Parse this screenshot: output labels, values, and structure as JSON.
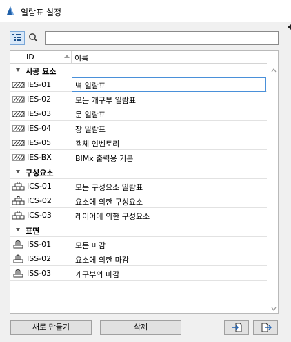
{
  "window": {
    "title": "일람표 설정"
  },
  "search": {
    "placeholder": "",
    "value": ""
  },
  "columns": {
    "id": "ID",
    "name": "이름"
  },
  "groups": [
    {
      "label": "시공 요소",
      "icon": "hatch-icon",
      "rows": [
        {
          "id": "IES-01",
          "name": "벽 일람표",
          "selected": true
        },
        {
          "id": "IES-02",
          "name": "모든 개구부 일람표"
        },
        {
          "id": "IES-03",
          "name": "문 일람표"
        },
        {
          "id": "IES-04",
          "name": "창 일람표"
        },
        {
          "id": "IES-05",
          "name": "객체 인벤토리"
        },
        {
          "id": "IES-BX",
          "name": "BIMx 출력용 기본"
        }
      ]
    },
    {
      "label": "구성요소",
      "icon": "components-icon",
      "rows": [
        {
          "id": "ICS-01",
          "name": "모든 구성요소 일람표"
        },
        {
          "id": "ICS-02",
          "name": "요소에 의한 구성요소"
        },
        {
          "id": "ICS-03",
          "name": "레이어에 의한 구성요소"
        }
      ]
    },
    {
      "label": "표면",
      "icon": "brush-icon",
      "rows": [
        {
          "id": "ISS-01",
          "name": "모든 마감"
        },
        {
          "id": "ISS-02",
          "name": "요소에 의한 마감"
        },
        {
          "id": "ISS-03",
          "name": "개구부의 마감"
        }
      ]
    }
  ],
  "buttons": {
    "new": "새로 만들기",
    "delete": "삭제"
  },
  "colors": {
    "accent": "#4a90d9",
    "toolbar_active": "#d9e8f8"
  }
}
